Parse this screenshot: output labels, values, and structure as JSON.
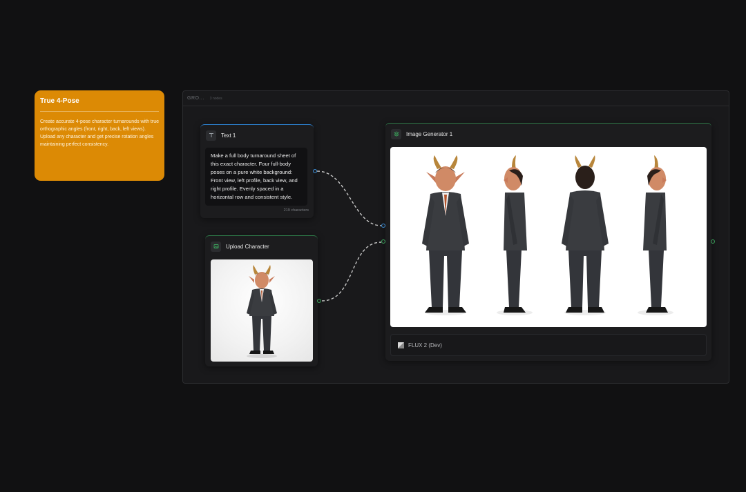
{
  "note": {
    "title": "True 4-Pose",
    "body": "Create accurate 4-pose character turnarounds with true orthographic angles (front, right, back, left views). Upload any character and get precise rotation angles maintaining perfect consistency.",
    "color": "#dc8a05"
  },
  "group": {
    "name": "GRO...",
    "count": "3 nodes"
  },
  "text_node": {
    "title": "Text 1",
    "icon": "text-icon",
    "content": "Make a full body turnaround sheet of this exact character. Four full-body poses on a pure white background: Front view, left profile, back view, and right profile. Evenly spaced in a horizontal row and consistent style.",
    "char_count": "219 characters",
    "accent": "#2c7ecb"
  },
  "upload_node": {
    "title": "Upload Character",
    "icon": "image-icon",
    "image": "devil-businessman-character",
    "accent": "#2f7d4a"
  },
  "generator_node": {
    "title": "Image Generator 1",
    "icon": "layers-icon",
    "image": "four-pose-turnaround-sheet",
    "model": "FLUX 2 (Dev)",
    "accent": "#2f7d4a"
  }
}
